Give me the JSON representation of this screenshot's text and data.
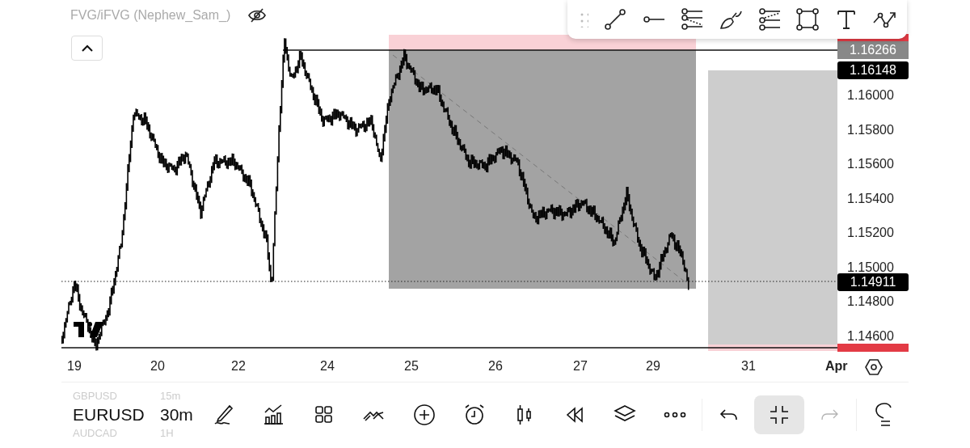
{
  "indicator_legend": {
    "title": "FVG/iFVG (Nephew_Sam_)",
    "hidden": true
  },
  "drawing_toolbar": {
    "tools": [
      {
        "kind": "handle"
      },
      {
        "kind": "trend-line"
      },
      {
        "kind": "horizontal-ray"
      },
      {
        "kind": "fib-retracement"
      },
      {
        "kind": "brush"
      },
      {
        "kind": "fib-channel"
      },
      {
        "kind": "rectangle"
      },
      {
        "kind": "text"
      },
      {
        "kind": "path"
      }
    ]
  },
  "price_scale": {
    "labels": [
      "1.16000",
      "1.15800",
      "1.15600",
      "1.15400",
      "1.15200",
      "1.15000",
      "1.14800",
      "1.14600"
    ],
    "tags": [
      {
        "kind": "alert"
      },
      {
        "kind": "line",
        "label": "1.16266"
      },
      {
        "kind": "price",
        "label": "1.16148"
      },
      {
        "kind": "price",
        "label": "1.14911"
      },
      {
        "kind": "alert"
      }
    ]
  },
  "time_scale": {
    "labels": [
      {
        "label": "19",
        "kind": "day"
      },
      {
        "label": "20",
        "kind": "day"
      },
      {
        "label": "22",
        "kind": "day"
      },
      {
        "label": "24",
        "kind": "day"
      },
      {
        "label": "25",
        "kind": "day"
      },
      {
        "label": "26",
        "kind": "day"
      },
      {
        "label": "27",
        "kind": "day"
      },
      {
        "label": "29",
        "kind": "day"
      },
      {
        "label": "31",
        "kind": "day"
      },
      {
        "label": "Apr",
        "kind": "month"
      }
    ]
  },
  "bottom_toolbar": {
    "symbols": [
      {
        "symbol": "GBPUSD",
        "interval": "15m",
        "selected": false
      },
      {
        "symbol": "EURUSD",
        "interval": "30m",
        "selected": true
      },
      {
        "symbol": "AUDCAD",
        "interval": "1H",
        "selected": false
      }
    ],
    "tools": [
      {
        "kind": "draw",
        "active": false,
        "disabled": false
      },
      {
        "kind": "indicators",
        "active": false,
        "disabled": false
      },
      {
        "kind": "layouts",
        "active": false,
        "disabled": false
      },
      {
        "kind": "patterns",
        "active": false,
        "disabled": false
      },
      {
        "kind": "add",
        "active": false,
        "disabled": false
      },
      {
        "kind": "alert",
        "active": false,
        "disabled": false
      },
      {
        "kind": "chart-type",
        "active": false,
        "disabled": false
      },
      {
        "kind": "replay",
        "active": false,
        "disabled": false
      },
      {
        "kind": "layers",
        "active": false,
        "disabled": false
      },
      {
        "kind": "more",
        "active": false,
        "disabled": false
      },
      {
        "kind": "undo",
        "active": false,
        "disabled": false
      },
      {
        "kind": "collapse",
        "active": true,
        "disabled": false
      },
      {
        "kind": "redo",
        "active": false,
        "disabled": true
      },
      {
        "kind": "idea",
        "active": false,
        "disabled": false
      }
    ]
  }
}
